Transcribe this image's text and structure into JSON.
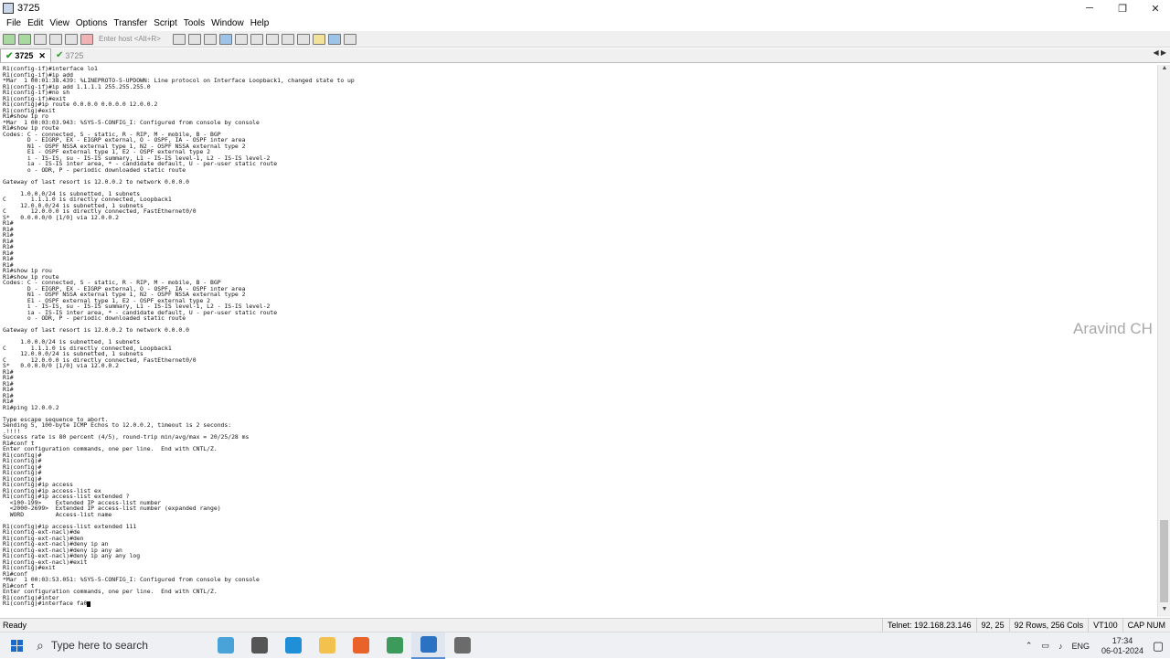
{
  "window": {
    "title": "3725",
    "controls": [
      "─",
      "❐",
      "✕"
    ]
  },
  "menu": [
    "File",
    "Edit",
    "View",
    "Options",
    "Transfer",
    "Script",
    "Tools",
    "Window",
    "Help"
  ],
  "toolbar": {
    "host_placeholder": "Enter host <Alt+R>"
  },
  "tabs": [
    {
      "label": "3725",
      "active": true,
      "close": "✕"
    },
    {
      "label": "3725",
      "active": false
    }
  ],
  "tab_nav": "◀ ▶",
  "terminal": {
    "lines": [
      "R1(config-if)#interface lo1",
      "R1(config-if)#ip add",
      "*Mar  1 00:01:38.439: %LINEPROTO-5-UPDOWN: Line protocol on Interface Loopback1, changed state to up",
      "R1(config-if)#ip add 1.1.1.1 255.255.255.0",
      "R1(config-if)#no sh",
      "R1(config-if)#exit",
      "R1(config)#ip route 0.0.0.0 0.0.0.0 12.0.0.2",
      "R1(config)#exit",
      "R1#show ip ro",
      "*Mar  1 00:03:03.943: %SYS-5-CONFIG_I: Configured from console by console",
      "R1#show ip route",
      "Codes: C - connected, S - static, R - RIP, M - mobile, B - BGP",
      "       D - EIGRP, EX - EIGRP external, O - OSPF, IA - OSPF inter area",
      "       N1 - OSPF NSSA external type 1, N2 - OSPF NSSA external type 2",
      "       E1 - OSPF external type 1, E2 - OSPF external type 2",
      "       i - IS-IS, su - IS-IS summary, L1 - IS-IS level-1, L2 - IS-IS level-2",
      "       ia - IS-IS inter area, * - candidate default, U - per-user static route",
      "       o - ODR, P - periodic downloaded static route",
      "",
      "Gateway of last resort is 12.0.0.2 to network 0.0.0.0",
      "",
      "     1.0.0.0/24 is subnetted, 1 subnets",
      "C       1.1.1.0 is directly connected, Loopback1",
      "     12.0.0.0/24 is subnetted, 1 subnets",
      "C       12.0.0.0 is directly connected, FastEthernet0/0",
      "S*   0.0.0.0/0 [1/0] via 12.0.0.2",
      "R1#",
      "R1#",
      "R1#",
      "R1#",
      "R1#",
      "R1#",
      "R1#",
      "R1#",
      "R1#show ip rou",
      "R1#show ip route",
      "Codes: C - connected, S - static, R - RIP, M - mobile, B - BGP",
      "       D - EIGRP, EX - EIGRP external, O - OSPF, IA - OSPF inter area",
      "       N1 - OSPF NSSA external type 1, N2 - OSPF NSSA external type 2",
      "       E1 - OSPF external type 1, E2 - OSPF external type 2",
      "       i - IS-IS, su - IS-IS summary, L1 - IS-IS level-1, L2 - IS-IS level-2",
      "       ia - IS-IS inter area, * - candidate default, U - per-user static route",
      "       o - ODR, P - periodic downloaded static route",
      "",
      "Gateway of last resort is 12.0.0.2 to network 0.0.0.0",
      "",
      "     1.0.0.0/24 is subnetted, 1 subnets",
      "C       1.1.1.0 is directly connected, Loopback1",
      "     12.0.0.0/24 is subnetted, 1 subnets",
      "C       12.0.0.0 is directly connected, FastEthernet0/0",
      "S*   0.0.0.0/0 [1/0] via 12.0.0.2",
      "R1#",
      "R1#",
      "R1#",
      "R1#",
      "R1#",
      "R1#",
      "R1#ping 12.0.0.2",
      "",
      "Type escape sequence to abort.",
      "Sending 5, 100-byte ICMP Echos to 12.0.0.2, timeout is 2 seconds:",
      ".!!!!",
      "Success rate is 80 percent (4/5), round-trip min/avg/max = 20/25/28 ms",
      "R1#conf t",
      "Enter configuration commands, one per line.  End with CNTL/Z.",
      "R1(config)#",
      "R1(config)#",
      "R1(config)#",
      "R1(config)#",
      "R1(config)#",
      "R1(config)#ip access",
      "R1(config)#ip access-list ex",
      "R1(config)#ip access-list extended ?",
      "  <100-199>    Extended IP access-list number",
      "  <2000-2699>  Extended IP access-list number (expanded range)",
      "  WORD         Access-list name",
      "",
      "R1(config)#ip access-list extended 111",
      "R1(config-ext-nacl)#de",
      "R1(config-ext-nacl)#den",
      "R1(config-ext-nacl)#deny ip an",
      "R1(config-ext-nacl)#deny ip any an",
      "R1(config-ext-nacl)#deny ip any any log",
      "R1(config-ext-nacl)#exit",
      "R1(config)#exit",
      "R1#conf",
      "*Mar  1 00:03:53.051: %SYS-5-CONFIG_I: Configured from console by console",
      "R1#conf t",
      "Enter configuration commands, one per line.  End with CNTL/Z.",
      "R1(config)#inter",
      "R1(config)#interface fa0"
    ]
  },
  "watermark": "Aravind CH",
  "status": {
    "ready": "Ready",
    "connection": "Telnet: 192.168.23.146",
    "cursor_pos": "92,  25",
    "dimensions": "92 Rows, 256 Cols",
    "emulation": "VT100",
    "caps": "CAP NUM"
  },
  "taskbar": {
    "search_placeholder": "Type here to search",
    "language": "ENG",
    "time": "17:34",
    "date": "06-01-2024",
    "pins": [
      {
        "name": "widgets-icon",
        "color": "#4aa3d8"
      },
      {
        "name": "task-view-icon",
        "color": "#555"
      },
      {
        "name": "edge-icon",
        "color": "#1f8fd8"
      },
      {
        "name": "file-explorer-icon",
        "color": "#f2c14e"
      },
      {
        "name": "firefox-icon",
        "color": "#e8622a"
      },
      {
        "name": "chart-app-icon",
        "color": "#3c9b5a"
      },
      {
        "name": "securecrt-icon",
        "color": "#2b72c2"
      },
      {
        "name": "gns3-icon",
        "color": "#6b6b6b"
      }
    ]
  }
}
